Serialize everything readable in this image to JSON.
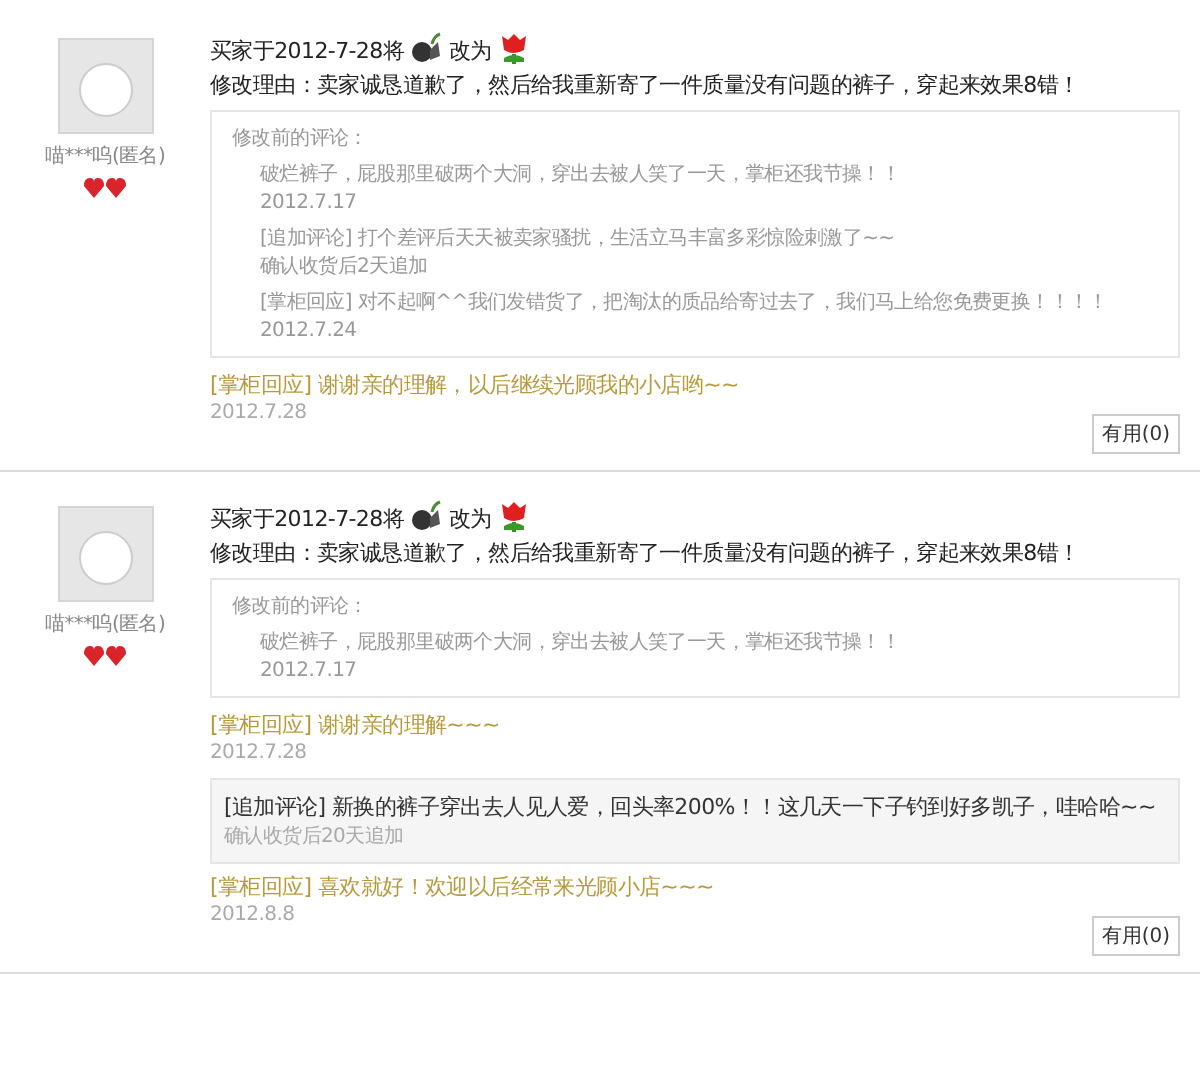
{
  "reviews": [
    {
      "user": "喵***呜(匿名)",
      "change_prefix": "买家于2012-7-28将",
      "change_middle": "改为",
      "reason": "修改理由：卖家诚恳道歉了，然后给我重新寄了一件质量没有问题的裤子，穿起来效果8错！",
      "previous": {
        "label": "修改前的评论：",
        "entries": [
          {
            "text": "破烂裤子，屁股那里破两个大洞，穿出去被人笑了一天，掌柜还我节操！！",
            "date": "2012.7.17"
          },
          {
            "text": "[追加评论] 打个差评后天天被卖家骚扰，生活立马丰富多彩惊险刺激了~~",
            "date": "确认收货后2天追加"
          },
          {
            "text": "[掌柜回应] 对不起啊^^我们发错货了，把淘汰的质品给寄过去了，我们马上给您免费更换！！！！",
            "date": "2012.7.24"
          }
        ]
      },
      "followups": [
        {
          "kind": "reply",
          "text": "[掌柜回应] 谢谢亲的理解，以后继续光顾我的小店哟~~",
          "date": "2012.7.28"
        }
      ],
      "helpful": "有用(0)"
    },
    {
      "user": "喵***呜(匿名)",
      "change_prefix": "买家于2012-7-28将",
      "change_middle": "改为",
      "reason": "修改理由：卖家诚恳道歉了，然后给我重新寄了一件质量没有问题的裤子，穿起来效果8错！",
      "previous": {
        "label": "修改前的评论：",
        "entries": [
          {
            "text": "破烂裤子，屁股那里破两个大洞，穿出去被人笑了一天，掌柜还我节操！！",
            "date": "2012.7.17"
          }
        ]
      },
      "followups": [
        {
          "kind": "reply",
          "text": "[掌柜回应] 谢谢亲的理解~~~",
          "date": "2012.7.28"
        },
        {
          "kind": "append",
          "text": "[追加评论] 新换的裤子穿出去人见人爱，回头率200%！！这几天一下子钓到好多凯子，哇哈哈~~",
          "date": "确认收货后20天追加"
        },
        {
          "kind": "reply",
          "text": "[掌柜回应] 喜欢就好！欢迎以后经常来光顾小店~~~",
          "date": "2012.8.8"
        }
      ],
      "helpful": "有用(0)"
    }
  ]
}
